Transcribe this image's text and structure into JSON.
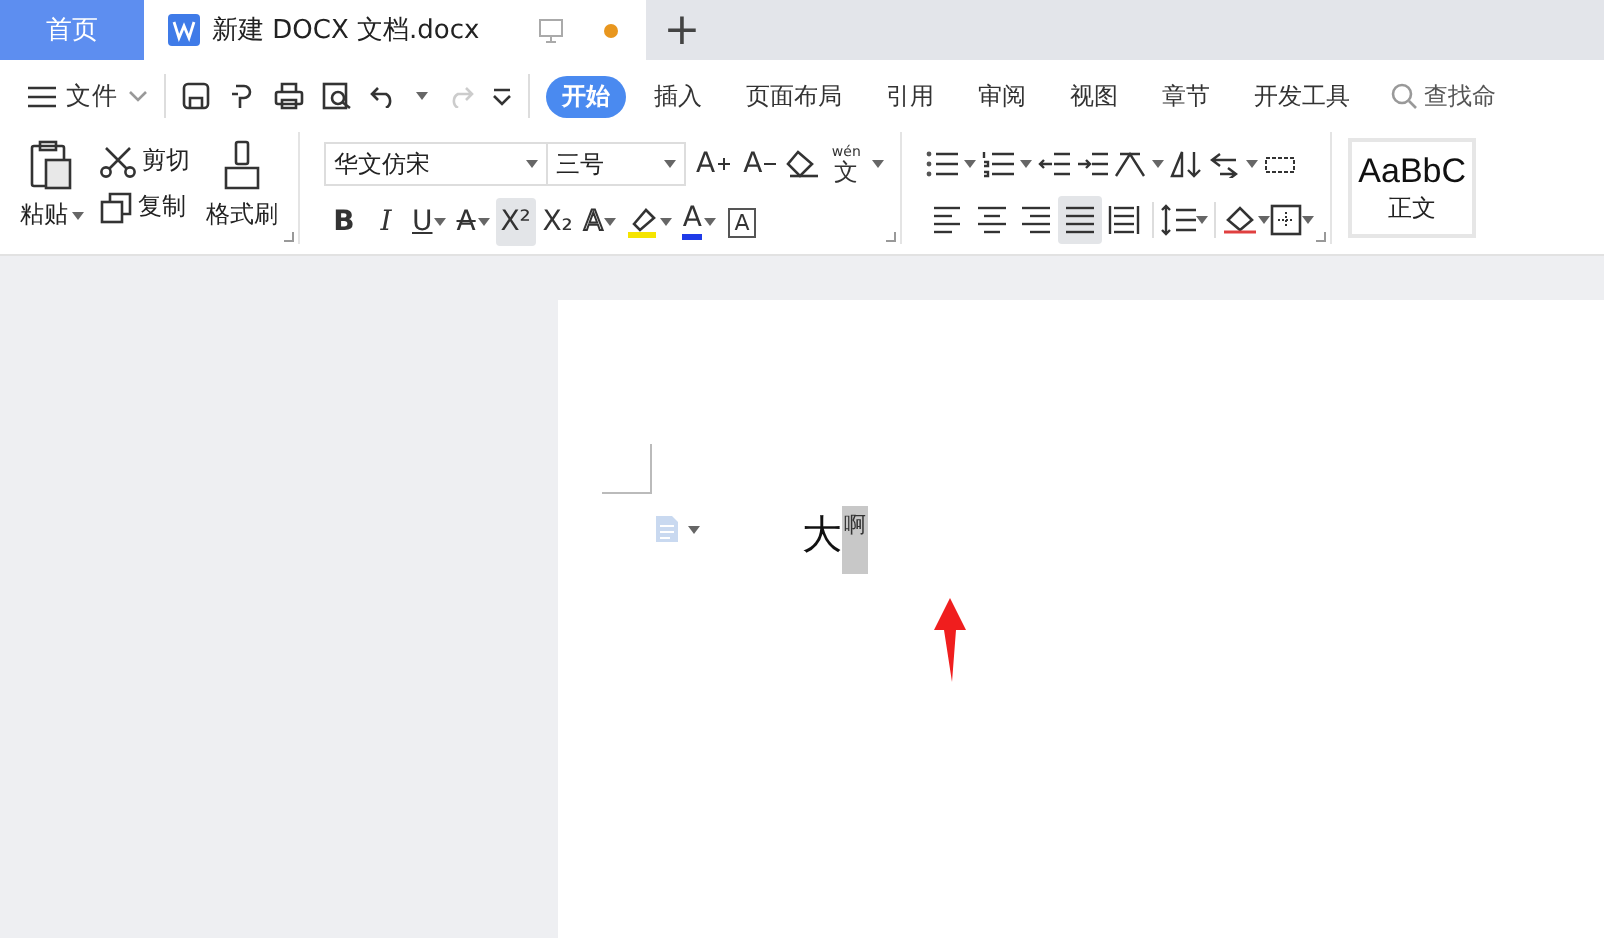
{
  "tabs": [
    {
      "kind": "home",
      "label": "首页",
      "selected": false
    },
    {
      "kind": "doc",
      "label": "新建 DOCX 文档.docx",
      "selected": true,
      "unsaved": true
    }
  ],
  "new_tab": "+",
  "menu": {
    "file": "文件",
    "ribbon_tabs": [
      {
        "label": "开始",
        "selected": true
      },
      {
        "label": "插入",
        "selected": false
      },
      {
        "label": "页面布局",
        "selected": false
      },
      {
        "label": "引用",
        "selected": false
      },
      {
        "label": "审阅",
        "selected": false
      },
      {
        "label": "视图",
        "selected": false
      },
      {
        "label": "章节",
        "selected": false
      },
      {
        "label": "开发工具",
        "selected": false
      }
    ],
    "search": {
      "placeholder": "查找命"
    }
  },
  "clipboard": {
    "paste": "粘贴",
    "cut": "剪切",
    "copy": "复制",
    "format_painter": "格式刷"
  },
  "font": {
    "name": "华文仿宋",
    "size": "三号",
    "grow": "A",
    "shrink": "A",
    "pinyin_top": "wén",
    "pinyin_bottom": "文",
    "buttons": [
      {
        "kind": "bold",
        "glyph": "B",
        "selected": false
      },
      {
        "kind": "italic",
        "glyph": "I",
        "selected": false
      },
      {
        "kind": "underline",
        "glyph": "U",
        "selected": false
      },
      {
        "kind": "strike",
        "glyph": "A",
        "selected": false
      },
      {
        "kind": "superscript",
        "glyph": "X²",
        "selected": true
      },
      {
        "kind": "subscript",
        "glyph": "X₂",
        "selected": false
      },
      {
        "kind": "effect",
        "glyph": "A",
        "selected": false
      },
      {
        "kind": "highlight",
        "selected": false
      },
      {
        "kind": "color",
        "glyph": "A",
        "selected": false
      },
      {
        "kind": "boxed",
        "glyph": "A",
        "selected": false
      }
    ]
  },
  "paragraph": {
    "align": [
      {
        "kind": "left",
        "selected": false
      },
      {
        "kind": "center",
        "selected": false
      },
      {
        "kind": "right",
        "selected": false
      },
      {
        "kind": "justify",
        "selected": true
      },
      {
        "kind": "distributed",
        "selected": false
      }
    ]
  },
  "styles": {
    "preview": "AaBbC",
    "name": "正文"
  },
  "document": {
    "text": "大",
    "superscript": {
      "text": "啊",
      "selected": true
    }
  }
}
